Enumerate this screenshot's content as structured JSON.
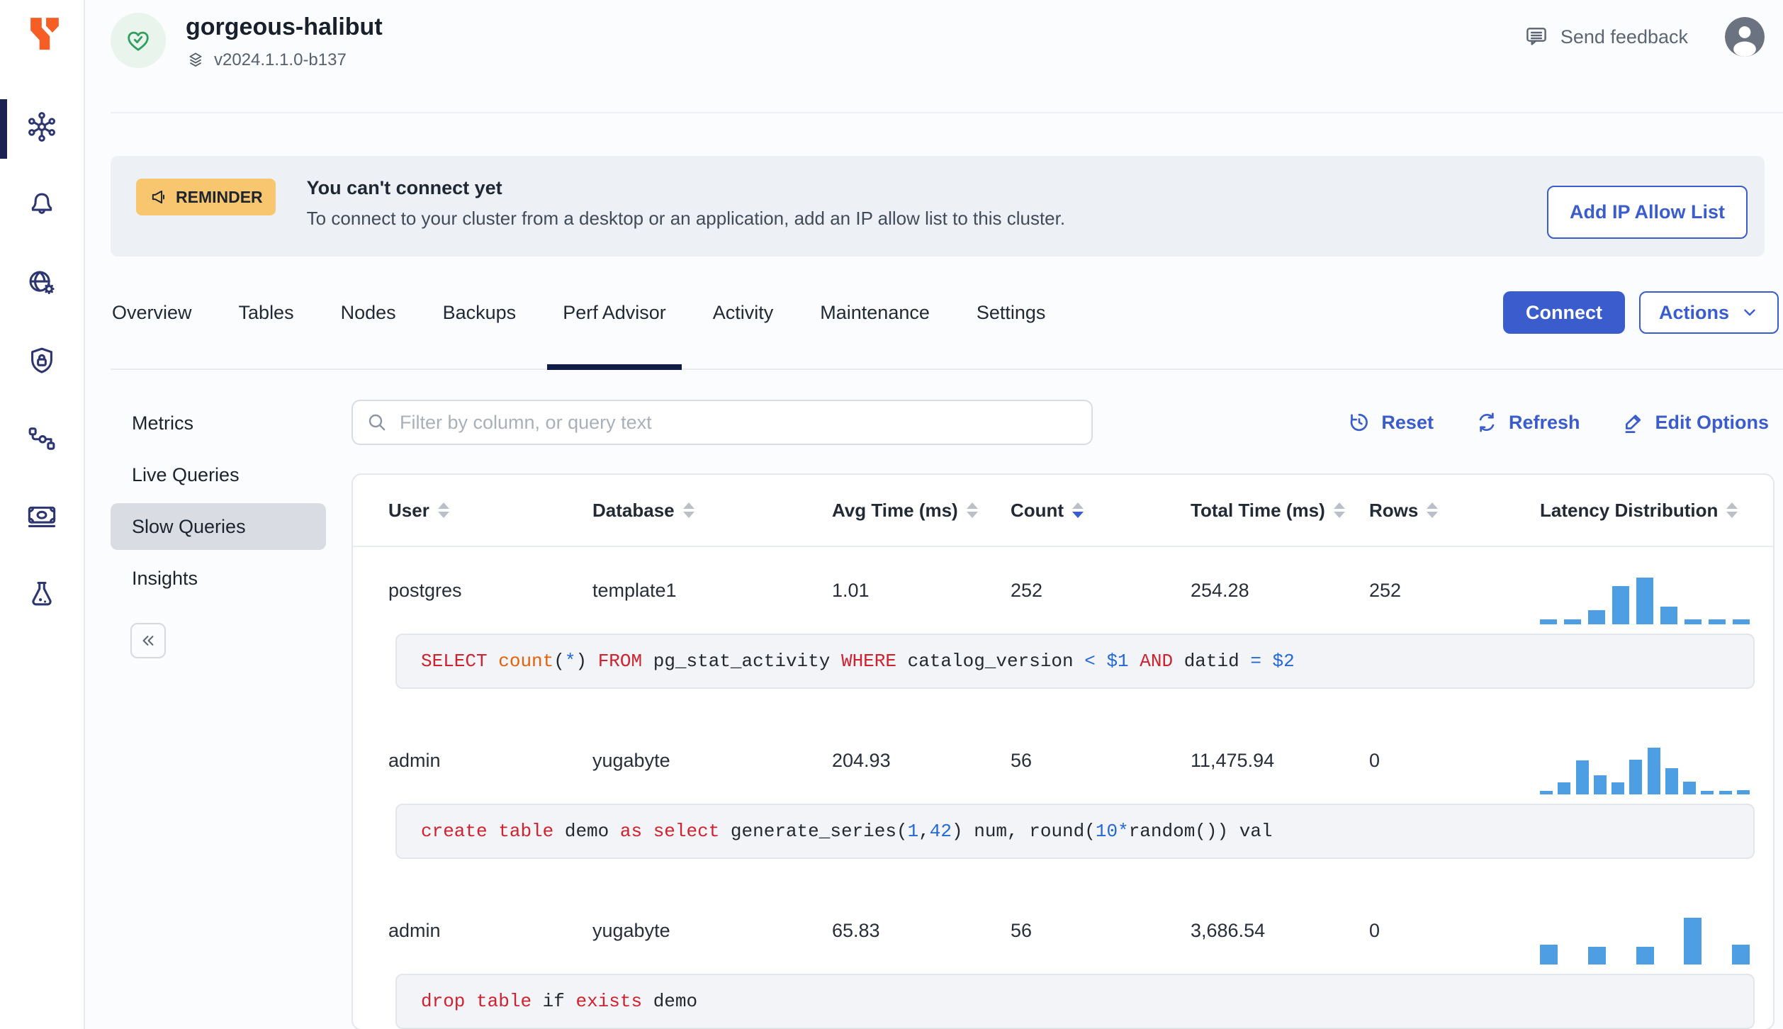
{
  "app": {
    "cluster_name": "gorgeous-halibut",
    "version": "v2024.1.1.0-b137",
    "send_feedback_label": "Send feedback"
  },
  "sidebar": {
    "icons": [
      "cluster-hub-icon",
      "notifications-bell-icon",
      "network-globe-gear-icon",
      "security-shield-lock-icon",
      "integrations-flow-icon",
      "billing-money-icon",
      "labs-flask-icon"
    ],
    "active_index": 0
  },
  "banner": {
    "badge_label": "REMINDER",
    "title": "You can't connect yet",
    "message": "To connect to your cluster from a desktop or an application, add an IP allow list to this cluster.",
    "action_label": "Add IP Allow List"
  },
  "tabs": {
    "items": [
      "Overview",
      "Tables",
      "Nodes",
      "Backups",
      "Perf Advisor",
      "Activity",
      "Maintenance",
      "Settings"
    ],
    "active": "Perf Advisor"
  },
  "cluster_actions": {
    "connect_label": "Connect",
    "actions_label": "Actions"
  },
  "subnav": {
    "items": [
      "Metrics",
      "Live Queries",
      "Slow Queries",
      "Insights"
    ],
    "active": "Slow Queries"
  },
  "toolbar": {
    "filter_placeholder": "Filter by column, or query text",
    "reset_label": "Reset",
    "refresh_label": "Refresh",
    "edit_options_label": "Edit Options"
  },
  "table": {
    "columns": [
      {
        "label": "User",
        "sort": "none"
      },
      {
        "label": "Database",
        "sort": "none"
      },
      {
        "label": "Avg Time (ms)",
        "sort": "none"
      },
      {
        "label": "Count",
        "sort": "desc"
      },
      {
        "label": "Total Time (ms)",
        "sort": "none"
      },
      {
        "label": "Rows",
        "sort": "none"
      },
      {
        "label": "Latency Distribution",
        "sort": "none"
      }
    ],
    "rows": [
      {
        "user": "postgres",
        "database": "template1",
        "avg_time_ms": "1.01",
        "count": "252",
        "total_time_ms": "254.28",
        "rows": "252",
        "latency_histogram_pct": [
          10,
          10,
          30,
          82,
          100,
          38,
          10,
          10,
          10
        ],
        "query": "SELECT count(*) FROM pg_stat_activity WHERE catalog_version < $1 AND datid = $2",
        "query_tokens": [
          [
            "SELECT",
            "k"
          ],
          [
            " ",
            "p"
          ],
          [
            "count",
            "f"
          ],
          [
            "(",
            "p"
          ],
          [
            "*",
            "n"
          ],
          [
            ")",
            "p"
          ],
          [
            " ",
            "p"
          ],
          [
            "FROM",
            "k"
          ],
          [
            " pg_stat_activity ",
            "p"
          ],
          [
            "WHERE",
            "k"
          ],
          [
            " catalog_version ",
            "p"
          ],
          [
            "<",
            "n"
          ],
          [
            " ",
            "p"
          ],
          [
            "$1",
            "n"
          ],
          [
            " ",
            "p"
          ],
          [
            "AND",
            "k"
          ],
          [
            " datid ",
            "p"
          ],
          [
            "=",
            "n"
          ],
          [
            " ",
            "p"
          ],
          [
            "$2",
            "n"
          ]
        ]
      },
      {
        "user": "admin",
        "database": "yugabyte",
        "avg_time_ms": "204.93",
        "count": "56",
        "total_time_ms": "11,475.94",
        "rows": "0",
        "latency_histogram_pct": [
          8,
          25,
          72,
          41,
          25,
          74,
          100,
          56,
          28,
          8,
          8,
          9
        ],
        "query": "create table demo as select generate_series(1,42) num, round(10*random()) val",
        "query_tokens": [
          [
            "create",
            "k"
          ],
          [
            " ",
            "p"
          ],
          [
            "table",
            "k"
          ],
          [
            " demo ",
            "p"
          ],
          [
            "as",
            "k"
          ],
          [
            " ",
            "p"
          ],
          [
            "select",
            "k"
          ],
          [
            " generate_series(",
            "p"
          ],
          [
            "1",
            "n"
          ],
          [
            ",",
            "p"
          ],
          [
            "42",
            "n"
          ],
          [
            ") num, round(",
            "p"
          ],
          [
            "10",
            "n"
          ],
          [
            "*",
            "n"
          ],
          [
            "random()) val",
            "p"
          ]
        ]
      },
      {
        "user": "admin",
        "database": "yugabyte",
        "avg_time_ms": "65.83",
        "count": "56",
        "total_time_ms": "3,686.54",
        "rows": "0",
        "latency_histogram_pct": [
          42,
          38,
          38,
          100,
          42
        ],
        "query": "drop table if exists demo",
        "query_tokens": [
          [
            "drop",
            "k"
          ],
          [
            " ",
            "p"
          ],
          [
            "table",
            "k"
          ],
          [
            " if ",
            "p"
          ],
          [
            "exists",
            "k"
          ],
          [
            " demo",
            "p"
          ]
        ]
      }
    ]
  },
  "colors": {
    "primary_blue": "#3a5ccc",
    "active_navy": "#1b2150",
    "histogram_bar": "#4d9ee3",
    "banner_bg": "#edf0f5",
    "reminder_amber": "#f7c66f",
    "sql_keyword_red": "#cf222e",
    "sql_function_orange": "#e36209",
    "sql_number_blue": "#2467d6",
    "success_green": "#2f9e5f"
  }
}
